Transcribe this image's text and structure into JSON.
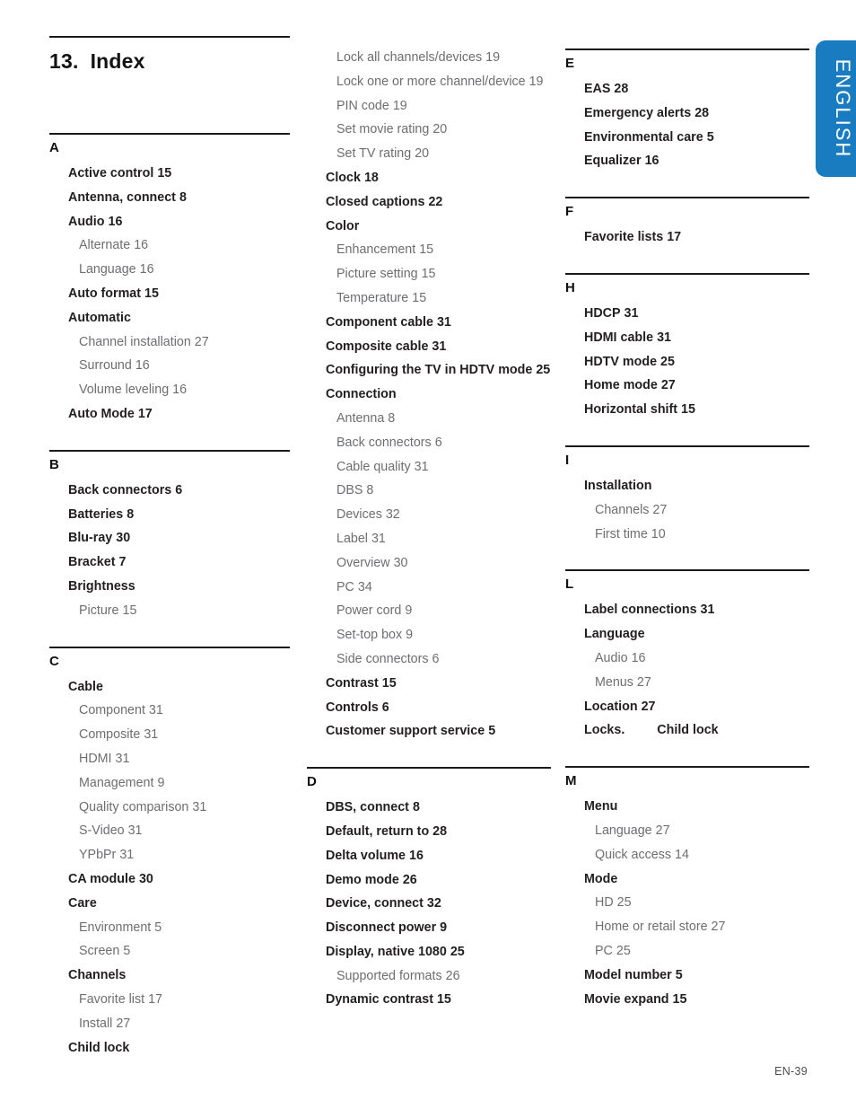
{
  "page": {
    "chapter_number": "13.",
    "title": "Index",
    "footer": "EN-39",
    "side_tab_label": "ENGLISH",
    "accent_color": "#1a7cc0",
    "text_color": "#231f20",
    "subentry_color": "#6d6e71"
  },
  "columns": [
    {
      "id": "column-1",
      "sections": [
        {
          "letter": "A",
          "entries": [
            {
              "label": "Active control",
              "page": "15",
              "level": 1
            },
            {
              "label": "Antenna, connect",
              "page": "8",
              "level": 1
            },
            {
              "label": "Audio",
              "page": "16",
              "level": 1
            },
            {
              "label": "Alternate",
              "page": "16",
              "level": 2
            },
            {
              "label": "Language",
              "page": "16",
              "level": 2
            },
            {
              "label": "Auto format",
              "page": "15",
              "level": 1
            },
            {
              "label": "Automatic",
              "page": "",
              "level": 1
            },
            {
              "label": "Channel installation",
              "page": "27",
              "level": 2
            },
            {
              "label": "Surround",
              "page": "16",
              "level": 2
            },
            {
              "label": "Volume leveling",
              "page": "16",
              "level": 2
            },
            {
              "label": "Auto Mode",
              "page": "17",
              "level": 1
            }
          ]
        },
        {
          "letter": "B",
          "entries": [
            {
              "label": "Back connectors",
              "page": "6",
              "level": 1
            },
            {
              "label": "Batteries",
              "page": "8",
              "level": 1
            },
            {
              "label": "Blu-ray",
              "page": "30",
              "level": 1
            },
            {
              "label": "Bracket",
              "page": "7",
              "level": 1
            },
            {
              "label": "Brightness",
              "page": "",
              "level": 1
            },
            {
              "label": "Picture",
              "page": "15",
              "level": 2
            }
          ]
        },
        {
          "letter": "C",
          "entries": [
            {
              "label": "Cable",
              "page": "",
              "level": 1
            },
            {
              "label": "Component",
              "page": "31",
              "level": 2
            },
            {
              "label": "Composite",
              "page": "31",
              "level": 2
            },
            {
              "label": "HDMI",
              "page": "31",
              "level": 2
            },
            {
              "label": "Management",
              "page": "9",
              "level": 2
            },
            {
              "label": "Quality comparison",
              "page": "31",
              "level": 2
            },
            {
              "label": "S-Video",
              "page": "31",
              "level": 2
            },
            {
              "label": "YPbPr",
              "page": "31",
              "level": 2
            },
            {
              "label": "CA module",
              "page": "30",
              "level": 1
            },
            {
              "label": "Care",
              "page": "",
              "level": 1
            },
            {
              "label": "Environment",
              "page": "5",
              "level": 2
            },
            {
              "label": "Screen",
              "page": "5",
              "level": 2
            },
            {
              "label": "Channels",
              "page": "",
              "level": 1
            },
            {
              "label": "Favorite list",
              "page": "17",
              "level": 2
            },
            {
              "label": "Install",
              "page": "27",
              "level": 2
            },
            {
              "label": "Child lock",
              "page": "",
              "level": 1
            }
          ]
        }
      ]
    },
    {
      "id": "column-2",
      "sections": [
        {
          "letter": "",
          "entries": [
            {
              "label": "Lock all channels/devices",
              "page": "19",
              "level": 2
            },
            {
              "label": "Lock one or more channel/device",
              "page": "19",
              "level": 2
            },
            {
              "label": "PIN code",
              "page": "19",
              "level": 2
            },
            {
              "label": "Set movie rating",
              "page": "20",
              "level": 2
            },
            {
              "label": "Set TV rating",
              "page": "20",
              "level": 2
            },
            {
              "label": "Clock",
              "page": "18",
              "level": 1
            },
            {
              "label": "Closed captions",
              "page": "22",
              "level": 1
            },
            {
              "label": "Color",
              "page": "",
              "level": 1
            },
            {
              "label": "Enhancement",
              "page": "15",
              "level": 2
            },
            {
              "label": "Picture setting",
              "page": "15",
              "level": 2
            },
            {
              "label": "Temperature",
              "page": "15",
              "level": 2
            },
            {
              "label": "Component cable",
              "page": "31",
              "level": 1
            },
            {
              "label": "Composite cable",
              "page": "31",
              "level": 1
            },
            {
              "label": "Configuring the TV in HDTV mode",
              "page": "25",
              "level": 1
            },
            {
              "label": "Connection",
              "page": "",
              "level": 1
            },
            {
              "label": "Antenna",
              "page": "8",
              "level": 2
            },
            {
              "label": "Back connectors",
              "page": "6",
              "level": 2
            },
            {
              "label": "Cable quality",
              "page": "31",
              "level": 2
            },
            {
              "label": "DBS",
              "page": "8",
              "level": 2
            },
            {
              "label": "Devices",
              "page": "32",
              "level": 2
            },
            {
              "label": "Label",
              "page": "31",
              "level": 2
            },
            {
              "label": "Overview",
              "page": "30",
              "level": 2
            },
            {
              "label": "PC",
              "page": "34",
              "level": 2
            },
            {
              "label": "Power cord",
              "page": "9",
              "level": 2
            },
            {
              "label": "Set-top box",
              "page": "9",
              "level": 2
            },
            {
              "label": "Side connectors",
              "page": "6",
              "level": 2
            },
            {
              "label": "Contrast",
              "page": "15",
              "level": 1
            },
            {
              "label": "Controls",
              "page": "6",
              "level": 1
            },
            {
              "label": "Customer support service",
              "page": "5",
              "level": 1
            }
          ]
        },
        {
          "letter": "D",
          "entries": [
            {
              "label": "DBS, connect",
              "page": "8",
              "level": 1
            },
            {
              "label": "Default, return to",
              "page": "28",
              "level": 1
            },
            {
              "label": "Delta volume",
              "page": "16",
              "level": 1
            },
            {
              "label": "Demo mode",
              "page": "26",
              "level": 1
            },
            {
              "label": "Device, connect",
              "page": "32",
              "level": 1
            },
            {
              "label": "Disconnect power",
              "page": "9",
              "level": 1
            },
            {
              "label": "Display, native 1080",
              "page": "25",
              "level": 1
            },
            {
              "label": "Supported formats",
              "page": "26",
              "level": 2
            },
            {
              "label": "Dynamic contrast",
              "page": "15",
              "level": 1
            }
          ]
        }
      ]
    },
    {
      "id": "column-3",
      "sections": [
        {
          "letter": "E",
          "entries": [
            {
              "label": "EAS",
              "page": "28",
              "level": 1
            },
            {
              "label": "Emergency alerts",
              "page": "28",
              "level": 1
            },
            {
              "label": "Environmental care",
              "page": "5",
              "level": 1
            },
            {
              "label": "Equalizer",
              "page": "16",
              "level": 1
            }
          ]
        },
        {
          "letter": "F",
          "entries": [
            {
              "label": "Favorite lists",
              "page": "17",
              "level": 1
            }
          ]
        },
        {
          "letter": "H",
          "entries": [
            {
              "label": "HDCP",
              "page": "31",
              "level": 1
            },
            {
              "label": "HDMI cable",
              "page": "31",
              "level": 1
            },
            {
              "label": "HDTV mode",
              "page": "25",
              "level": 1
            },
            {
              "label": "Home mode",
              "page": "27",
              "level": 1
            },
            {
              "label": "Horizontal shift",
              "page": "15",
              "level": 1
            }
          ]
        },
        {
          "letter": "I",
          "entries": [
            {
              "label": "Installation",
              "page": "",
              "level": 1
            },
            {
              "label": "Channels",
              "page": "27",
              "level": 2
            },
            {
              "label": "First time",
              "page": "10",
              "level": 2
            }
          ]
        },
        {
          "letter": "L",
          "entries": [
            {
              "label": "Label connections",
              "page": "31",
              "level": 1
            },
            {
              "label": "Language",
              "page": "",
              "level": 1
            },
            {
              "label": "Audio",
              "page": "16",
              "level": 2
            },
            {
              "label": "Menus",
              "page": "27",
              "level": 2
            },
            {
              "label": "Location",
              "page": "27",
              "level": 1
            },
            {
              "label": "Locks.",
              "page": "",
              "level": 1,
              "xref": "Child lock"
            }
          ]
        },
        {
          "letter": "M",
          "entries": [
            {
              "label": "Menu",
              "page": "",
              "level": 1
            },
            {
              "label": "Language",
              "page": "27",
              "level": 2
            },
            {
              "label": "Quick access",
              "page": "14",
              "level": 2
            },
            {
              "label": "Mode",
              "page": "",
              "level": 1
            },
            {
              "label": "HD",
              "page": "25",
              "level": 2
            },
            {
              "label": "Home or retail store",
              "page": "27",
              "level": 2
            },
            {
              "label": "PC",
              "page": "25",
              "level": 2
            },
            {
              "label": "Model number",
              "page": "5",
              "level": 1
            },
            {
              "label": "Movie expand",
              "page": "15",
              "level": 1
            }
          ]
        }
      ]
    }
  ]
}
